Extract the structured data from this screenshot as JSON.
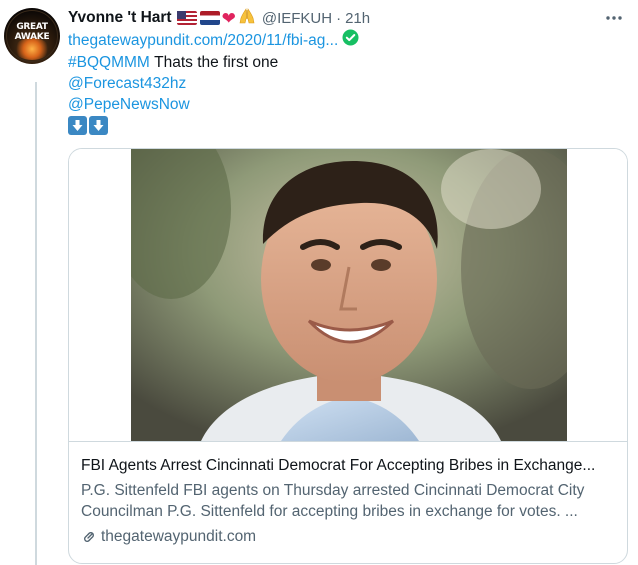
{
  "tweet": {
    "display_name": "Yvonne 't Hart",
    "avatar_text": "GREAT AWAKE",
    "emoji": [
      "us-flag",
      "nl-flag",
      "red-heart",
      "folded-hands"
    ],
    "heart_glyph": "❤",
    "pray_glyph": "🙏",
    "handle": "@IEFKUH",
    "separator": "·",
    "time": "21h",
    "link_text": "thegatewaypundit.com/2020/11/fbi-ag...",
    "hashtag": "#BQQMMM",
    "text_after_hashtag": "Thats the first one",
    "mention_1": "@Forecast432hz",
    "mention_2": "@PepeNewsNow",
    "arrow_emoji": [
      "down-arrow-button",
      "down-arrow-button"
    ]
  },
  "card": {
    "title": "FBI Agents Arrest Cincinnati Democrat For Accepting Bribes in Exchange...",
    "description_line_1": "P.G. Sittenfeld FBI agents on Thursday arrested Cincinnati Democrat City",
    "description_line_2": "Councilman P.G. Sittenfeld for accepting bribes in exchange for votes. ...",
    "domain": "thegatewaypundit.com"
  },
  "colors": {
    "link": "#1b95e0",
    "secondary_text": "#536471",
    "verified": "#17bf63",
    "border": "#cfd9de"
  }
}
